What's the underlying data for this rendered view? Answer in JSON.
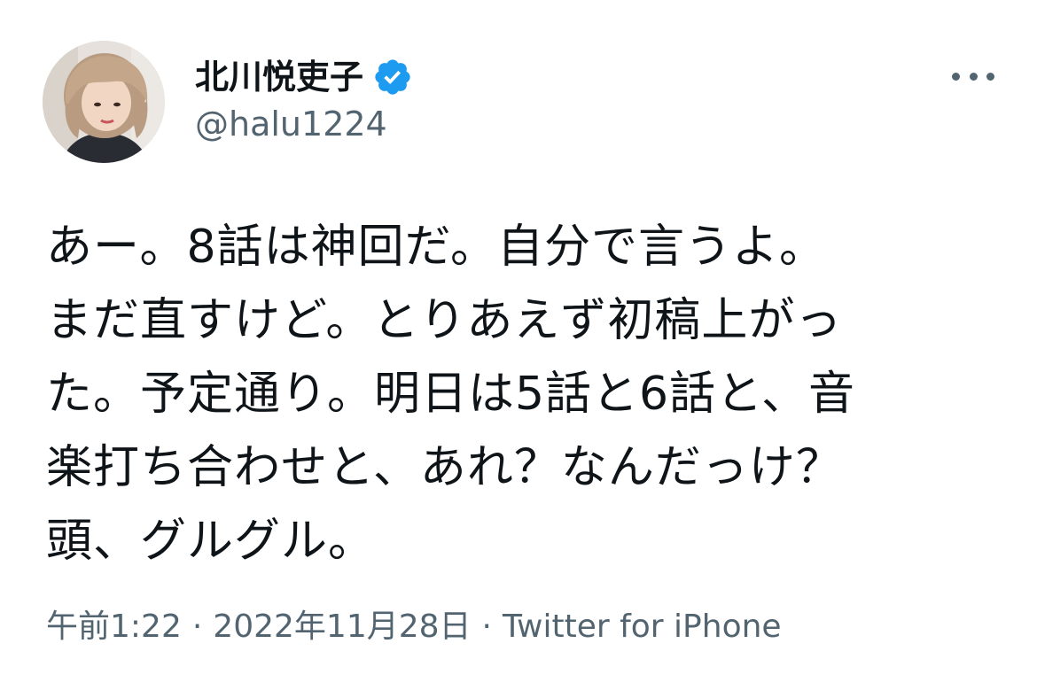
{
  "author": {
    "display_name": "北川悦吏子",
    "handle": "@halu1224",
    "verified_icon": "verified-badge-icon",
    "verified_color": "#1d9bf0"
  },
  "tweet": {
    "lines": [
      "あー。8話は神回だ。自分で言うよ。",
      "まだ直すけど。とりあえず初稿上がっ",
      "た。予定通り。明日は5話と6話と、音",
      "楽打ち合わせと、あれ？なんだっけ？",
      "頭、グルグル。"
    ]
  },
  "meta": {
    "time": "午前1:22",
    "separator": "·",
    "date": "2022年11月28日",
    "source": "Twitter for iPhone"
  },
  "menu": {
    "more_icon": "more-options-icon"
  },
  "colors": {
    "text_primary": "#0f1419",
    "text_secondary": "#536471",
    "accent": "#1d9bf0",
    "background": "#ffffff"
  }
}
